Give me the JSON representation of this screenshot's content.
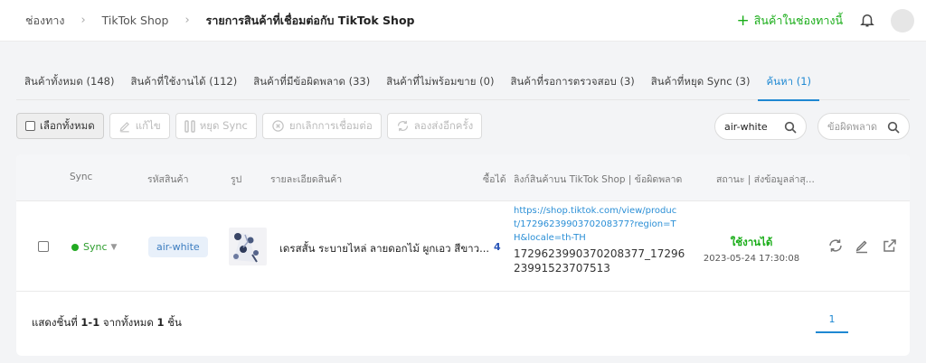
{
  "header": {
    "breadcrumb": [
      "ช่องทาง",
      "TikTok Shop",
      "รายการสินค้าที่เชื่อมต่อกับ TikTok Shop"
    ],
    "add_product_label": "สินค้าในช่องทางนี้"
  },
  "tabs": [
    {
      "label": "สินค้าทั้งหมด (148)",
      "active": false
    },
    {
      "label": "สินค้าที่ใช้งานได้ (112)",
      "active": false
    },
    {
      "label": "สินค้าที่มีข้อผิดพลาด (33)",
      "active": false
    },
    {
      "label": "สินค้าที่ไม่พร้อมขาย (0)",
      "active": false
    },
    {
      "label": "สินค้าที่รอการตรวจสอบ (3)",
      "active": false
    },
    {
      "label": "สินค้าที่หยุด Sync (3)",
      "active": false
    },
    {
      "label": "ค้นหา (1)",
      "active": true
    }
  ],
  "toolbar": {
    "select_all": "เลือกทั้งหมด",
    "edit": "แก้ไข",
    "stop_sync": "หยุด Sync",
    "unlink": "ยกเลิกการเชื่อมต่อ",
    "retry": "ลองส่งอีกครั้ง"
  },
  "search": {
    "value": "air-white",
    "error_placeholder": "ข้อผิดพลาด"
  },
  "table": {
    "columns": [
      "Sync",
      "รหัสสินค้า",
      "รูป",
      "รายละเอียดสินค้า",
      "ซื้อได้",
      "ลิงก์สินค้าบน TikTok Shop | ข้อผิดพลาด",
      "สถานะ | ส่งข้อมูลล่าสุ..."
    ],
    "rows": [
      {
        "sync": "Sync",
        "sku": "air-white",
        "description": "เดรสสั้น ระบายไหล่ ลายดอกไม้ ผูกเอว สีขาว...",
        "qty": "4",
        "link": "https://shop.tiktok.com/view/product/1729623990370208377?region=TH&locale=th-TH",
        "ids": "1729623990370208377_1729623991523707513",
        "status": "ใช้งานได้",
        "timestamp": "2023-05-24 17:30:08"
      }
    ]
  },
  "footer": {
    "prefix": "แสดงชิ้นที่",
    "range": "1-1",
    "middle": "จากทั้งหมด",
    "total": "1",
    "suffix": "ชิ้น",
    "page": "1"
  }
}
